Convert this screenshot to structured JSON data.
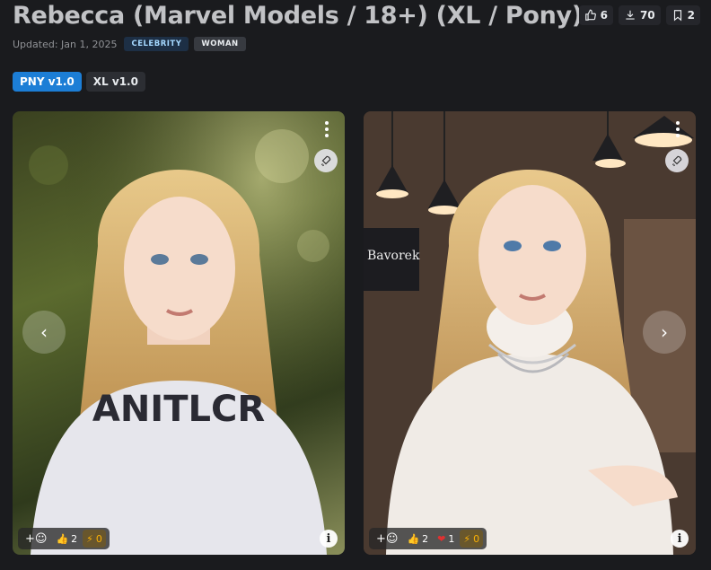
{
  "model": {
    "title": "Rebecca (Marvel Models / 18+) (XL / Pony)",
    "updated": "Updated: Jan 1, 2025",
    "tags": [
      "CELEBRITY",
      "WOMAN"
    ]
  },
  "stats": {
    "likes": "6",
    "downloads": "70",
    "bookmarks": "2",
    "icons": {
      "likes": "thumbs-up-icon",
      "downloads": "download-icon",
      "bookmarks": "bookmark-icon"
    }
  },
  "versions": [
    {
      "label": "PNY v1.0",
      "active": true
    },
    {
      "label": "XL v1.0",
      "active": false
    }
  ],
  "gallery": {
    "cards": [
      {
        "reactions": {
          "add": "+☺",
          "like": "2",
          "buzz": "0"
        },
        "caption_text_on_shirt": "ANITLCR"
      },
      {
        "reactions": {
          "add": "+☺",
          "like": "2",
          "heart": "1",
          "buzz": "0"
        },
        "sign_text": "Bavorek"
      }
    ],
    "nav": {
      "prev": "‹",
      "next": "›"
    }
  },
  "colors": {
    "background": "#1a1b1e",
    "accent": "#1c7ed6",
    "tag_celebrity_bg": "#1d2f45",
    "buzz": "#fab005",
    "heart": "#e03131"
  }
}
